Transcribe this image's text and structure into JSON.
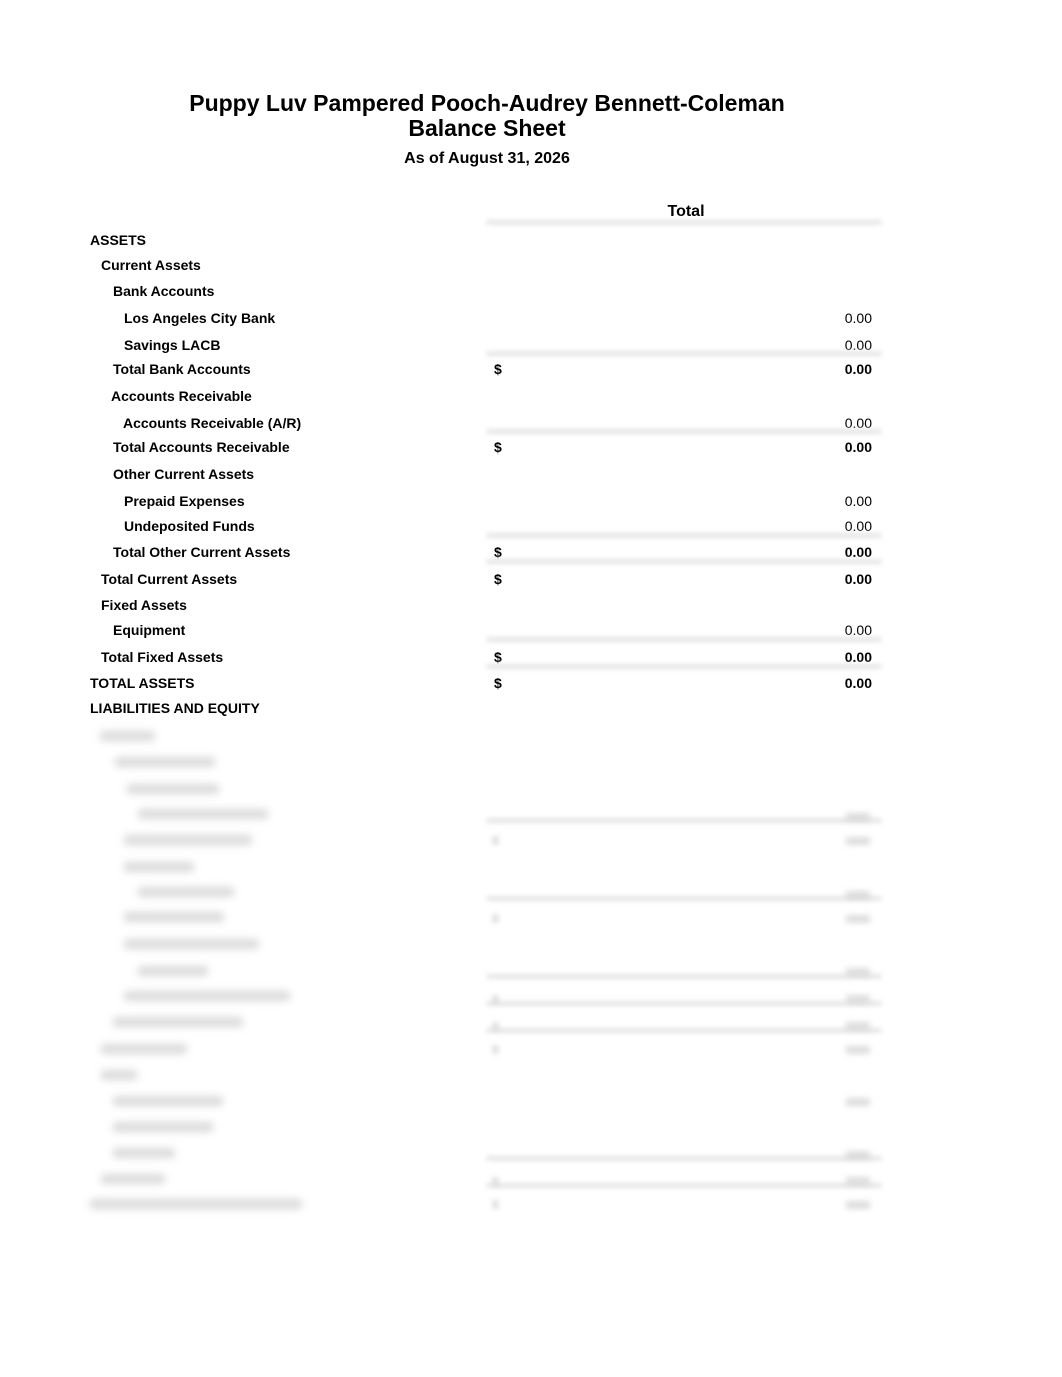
{
  "header": {
    "company": "Puppy Luv Pampered Pooch-Audrey Bennett-Coleman",
    "title": "Balance Sheet",
    "as_of": "As of August 31, 2026"
  },
  "column_header": "Total",
  "currency_symbol": "$",
  "rows": [
    {
      "label": "ASSETS",
      "level": 0,
      "type": "section",
      "amount": ""
    },
    {
      "label": "Current Assets",
      "level": 1,
      "type": "section",
      "amount": ""
    },
    {
      "label": "Bank Accounts",
      "level": 2,
      "type": "section",
      "amount": ""
    },
    {
      "label": "Los Angeles City Bank",
      "level": 3,
      "type": "line",
      "amount": "0.00"
    },
    {
      "label": "Savings LACB",
      "level": 3,
      "type": "line",
      "amount": "0.00"
    },
    {
      "label": "Total Bank Accounts",
      "level": 2,
      "type": "total",
      "amount": "0.00"
    },
    {
      "label": "Accounts Receivable",
      "level": 2,
      "type": "section",
      "amount": ""
    },
    {
      "label": "Accounts Receivable (A/R)",
      "level": 3,
      "type": "line",
      "amount": "0.00"
    },
    {
      "label": "Total Accounts Receivable",
      "level": 2,
      "type": "total",
      "amount": "0.00"
    },
    {
      "label": "Other Current Assets",
      "level": 2,
      "type": "section",
      "amount": ""
    },
    {
      "label": "Prepaid Expenses",
      "level": 3,
      "type": "line",
      "amount": "0.00"
    },
    {
      "label": "Undeposited Funds",
      "level": 3,
      "type": "line",
      "amount": "0.00"
    },
    {
      "label": "Total Other Current Assets",
      "level": 2,
      "type": "total",
      "amount": "0.00"
    },
    {
      "label": "Total Current Assets",
      "level": 1,
      "type": "total",
      "amount": "0.00"
    },
    {
      "label": "Fixed Assets",
      "level": 1,
      "type": "section",
      "amount": ""
    },
    {
      "label": "Equipment",
      "level": 2,
      "type": "line",
      "amount": "0.00"
    },
    {
      "label": "Total Fixed Assets",
      "level": 1,
      "type": "total",
      "amount": "0.00"
    },
    {
      "label": "TOTAL ASSETS",
      "level": 0,
      "type": "total",
      "amount": "0.00"
    },
    {
      "label": "LIABILITIES AND EQUITY",
      "level": 0,
      "type": "section",
      "amount": ""
    }
  ],
  "blurred_section": {
    "note": "remaining rows obscured (blurred) in the screenshot"
  }
}
